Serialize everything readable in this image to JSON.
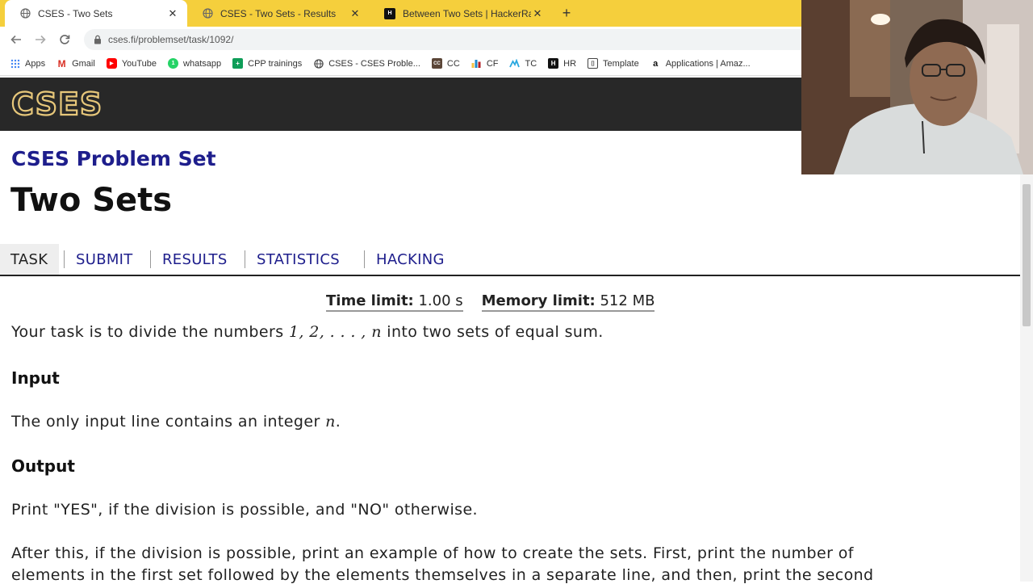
{
  "browser": {
    "tabs": [
      {
        "title": "CSES - Two Sets",
        "active": true,
        "favicon": "globe-icon"
      },
      {
        "title": "CSES - Two Sets - Results",
        "active": false,
        "favicon": "globe-icon"
      },
      {
        "title": "Between Two Sets | HackerRank",
        "active": false,
        "favicon": "hackerrank-icon"
      }
    ],
    "url": "cses.fi/problemset/task/1092/",
    "bookmarks": [
      {
        "label": "Apps",
        "icon": "apps-grid-icon",
        "color": "#4285f4"
      },
      {
        "label": "Gmail",
        "icon": "gmail-icon",
        "color": "#d93025"
      },
      {
        "label": "YouTube",
        "icon": "youtube-icon",
        "color": "#ff0000"
      },
      {
        "label": "whatsapp",
        "icon": "whatsapp-icon",
        "color": "#25d366"
      },
      {
        "label": "CPP trainings",
        "icon": "cpp-trainings-icon",
        "color": "#0f9d58"
      },
      {
        "label": "CSES - CSES Proble...",
        "icon": "globe-icon",
        "color": "#555555"
      },
      {
        "label": "CC",
        "icon": "codechef-icon",
        "color": "#5b4638"
      },
      {
        "label": "CF",
        "icon": "codeforces-icon",
        "color": "#1f8acb"
      },
      {
        "label": "TC",
        "icon": "topcoder-icon",
        "color": "#29a8e0"
      },
      {
        "label": "HR",
        "icon": "hackerrank-icon",
        "color": "#111111"
      },
      {
        "label": "Template",
        "icon": "template-icon",
        "color": "#444444"
      },
      {
        "label": "Applications | Amaz...",
        "icon": "amazon-icon",
        "color": "#ff9900"
      }
    ]
  },
  "site": {
    "logo_text": "CSES",
    "problemset_title": "CSES Problem Set",
    "task_title": "Two Sets",
    "nav": [
      {
        "label": "TASK",
        "current": true
      },
      {
        "label": "SUBMIT",
        "current": false
      },
      {
        "label": "RESULTS",
        "current": false
      },
      {
        "label": "STATISTICS",
        "current": false
      },
      {
        "label": "HACKING",
        "current": false
      }
    ],
    "limits": {
      "time_label": "Time limit:",
      "time_value": "1.00 s",
      "memory_label": "Memory limit:",
      "memory_value": "512 MB"
    },
    "statement": {
      "intro_a": "Your task is to divide the numbers ",
      "intro_math": "1, 2, . . . , n",
      "intro_b": " into two sets of equal sum.",
      "input_heading": "Input",
      "input_a": "The only input line contains an integer ",
      "input_math": "n",
      "input_b": ".",
      "output_heading": "Output",
      "output_text": "Print \"YES\", if the division is possible, and \"NO\" otherwise.",
      "after_line1": "After this, if the division is possible, print an example of how to create the sets. First, print the number of",
      "after_line2": "elements in the first set followed by the elements themselves in a separate line, and then, print the second"
    }
  },
  "colors": {
    "tabstrip": "#f5cf3c",
    "header_bg": "#282828",
    "accent": "#1e1e8c"
  }
}
